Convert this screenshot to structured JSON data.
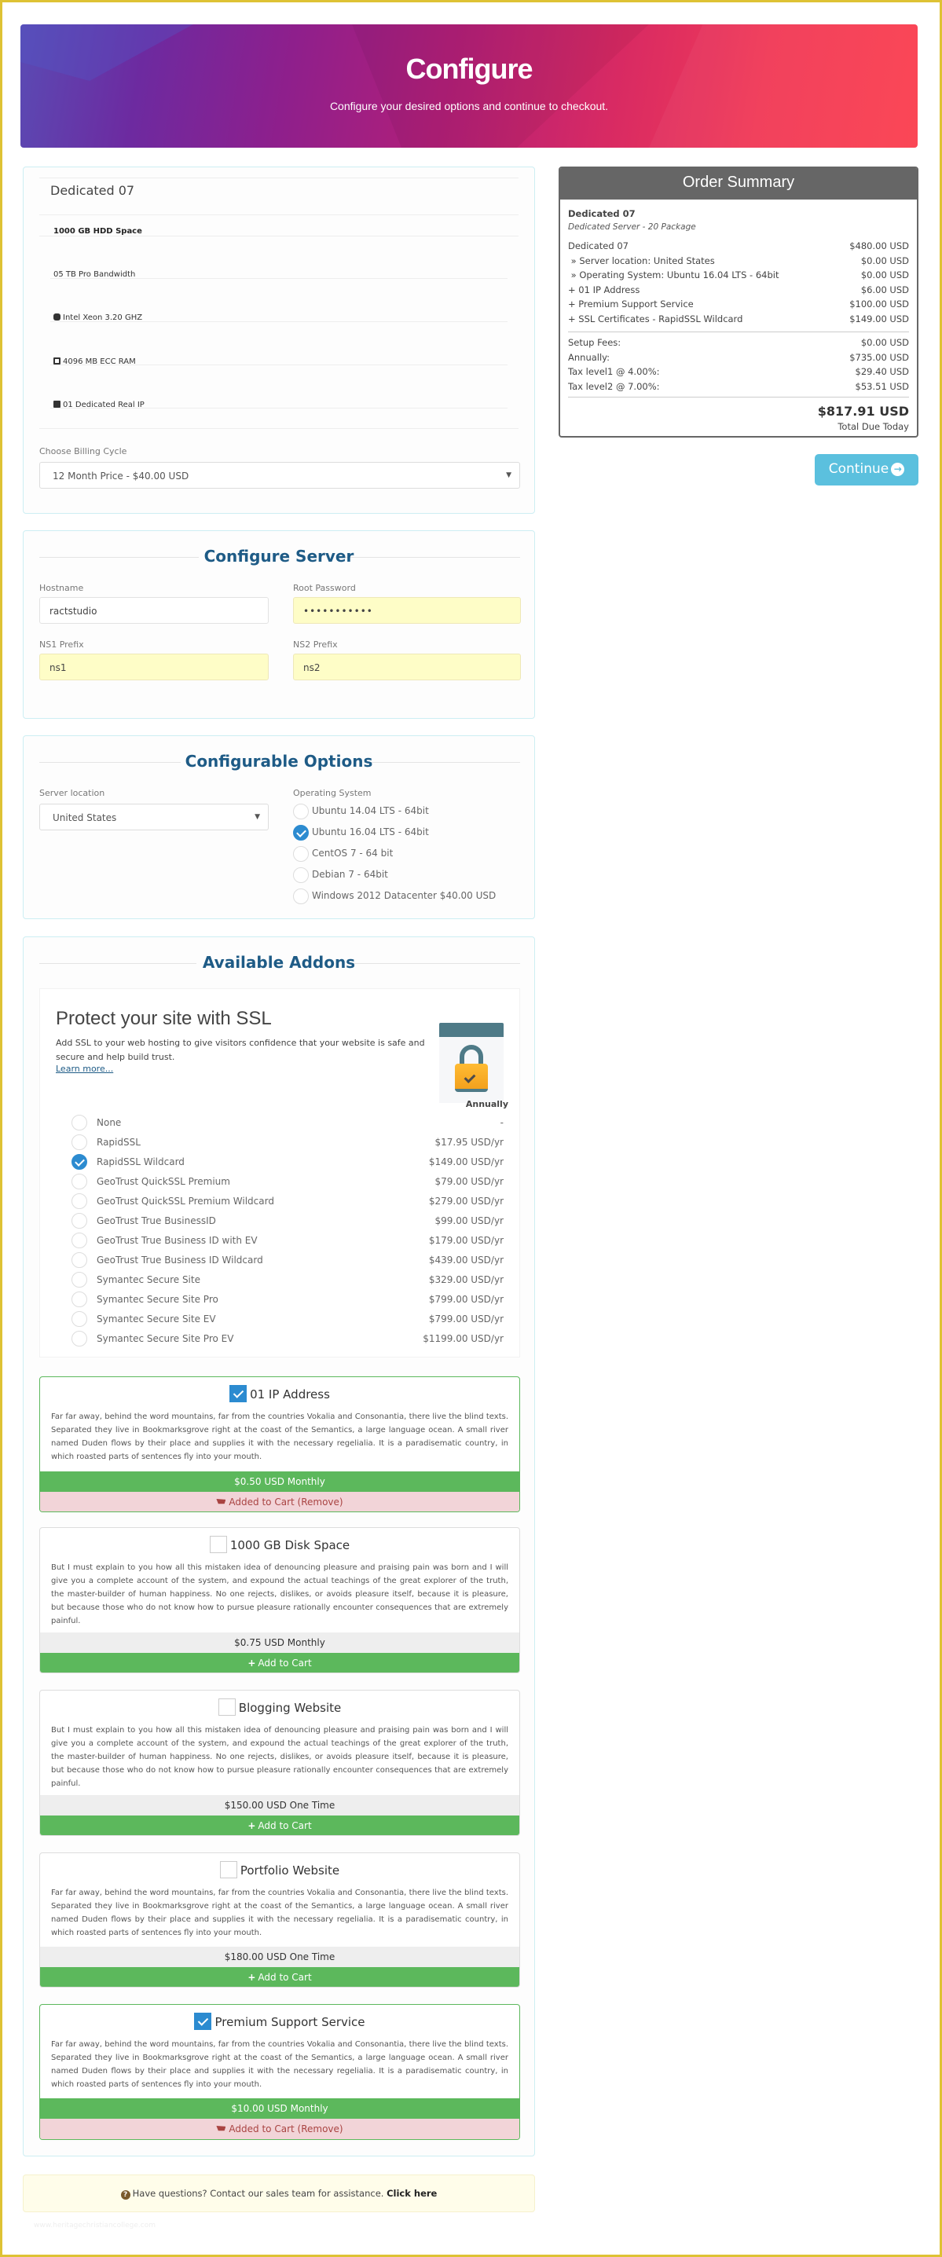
{
  "header": {
    "title": "Configure",
    "subtitle": "Configure your desired options and continue to checkout."
  },
  "product": {
    "name": "Dedicated 07",
    "features": [
      {
        "icon": "none",
        "text": "1000 GB HDD Space"
      },
      {
        "icon": "none",
        "text": "05 TB Pro Bandwidth"
      },
      {
        "icon": "database-icon",
        "text": "Intel Xeon 3.20 GHZ"
      },
      {
        "icon": "columns-icon",
        "text": "4096 MB ECC RAM"
      },
      {
        "icon": "server-icon",
        "text": "01 Dedicated Real IP"
      }
    ],
    "billing_label": "Choose Billing Cycle",
    "billing_value": "12 Month Price - $40.00 USD"
  },
  "configure_server": {
    "title": "Configure Server",
    "hostname_label": "Hostname",
    "hostname_value": "ractstudio",
    "password_label": "Root Password",
    "password_value": "•••••••••••",
    "ns1_label": "NS1 Prefix",
    "ns1_value": "ns1",
    "ns2_label": "NS2 Prefix",
    "ns2_value": "ns2"
  },
  "configurable_options": {
    "title": "Configurable Options",
    "location_label": "Server location",
    "location_value": "United States",
    "os_label": "Operating System",
    "os_options": [
      {
        "label": "Ubuntu 14.04 LTS - 64bit",
        "selected": false
      },
      {
        "label": "Ubuntu 16.04 LTS - 64bit",
        "selected": true
      },
      {
        "label": "CentOS 7 - 64 bit",
        "selected": false
      },
      {
        "label": "Debian 7 - 64bit",
        "selected": false
      },
      {
        "label": "Windows 2012 Datacenter $40.00 USD",
        "selected": false
      }
    ]
  },
  "addons": {
    "title": "Available Addons",
    "ssl": {
      "title": "Protect your site with SSL",
      "description": "Add SSL to your web hosting to give visitors confidence that your website is safe and secure and help build trust.",
      "learn_more": "Learn more...",
      "column_header": "Annually",
      "options": [
        {
          "name": "None",
          "price": "-",
          "selected": false
        },
        {
          "name": "RapidSSL",
          "price": "$17.95 USD/yr",
          "selected": false
        },
        {
          "name": "RapidSSL Wildcard",
          "price": "$149.00 USD/yr",
          "selected": true
        },
        {
          "name": "GeoTrust QuickSSL Premium",
          "price": "$79.00 USD/yr",
          "selected": false
        },
        {
          "name": "GeoTrust QuickSSL Premium Wildcard",
          "price": "$279.00 USD/yr",
          "selected": false
        },
        {
          "name": "GeoTrust True BusinessID",
          "price": "$99.00 USD/yr",
          "selected": false
        },
        {
          "name": "GeoTrust True Business ID with EV",
          "price": "$179.00 USD/yr",
          "selected": false
        },
        {
          "name": "GeoTrust True Business ID Wildcard",
          "price": "$439.00 USD/yr",
          "selected": false
        },
        {
          "name": "Symantec Secure Site",
          "price": "$329.00 USD/yr",
          "selected": false
        },
        {
          "name": "Symantec Secure Site Pro",
          "price": "$799.00 USD/yr",
          "selected": false
        },
        {
          "name": "Symantec Secure Site EV",
          "price": "$799.00 USD/yr",
          "selected": false
        },
        {
          "name": "Symantec Secure Site Pro EV",
          "price": "$1199.00 USD/yr",
          "selected": false
        }
      ]
    },
    "items": [
      {
        "name": "01 IP Address",
        "checked": true,
        "description": "Far far away, behind the word mountains, far from the countries Vokalia and Consonantia, there live the blind texts. Separated they live in Bookmarksgrove right at the coast of the Semantics, a large language ocean. A small river named Duden flows by their place and supplies it with the necessary regelialia. It is a paradisematic country, in which roasted parts of sentences fly into your mouth.",
        "price": "$0.50 USD Monthly",
        "action": "Added to Cart (Remove)"
      },
      {
        "name": "1000 GB Disk Space",
        "checked": false,
        "description": "But I must explain to you how all this mistaken idea of denouncing pleasure and praising pain was born and I will give you a complete account of the system, and expound the actual teachings of the great explorer of the truth, the master-builder of human happiness. No one rejects, dislikes, or avoids pleasure itself, because it is pleasure, but because those who do not know how to pursue pleasure rationally encounter consequences that are extremely painful.",
        "price": "$0.75 USD Monthly",
        "action": "Add to Cart"
      },
      {
        "name": "Blogging Website",
        "checked": false,
        "description": "But I must explain to you how all this mistaken idea of denouncing pleasure and praising pain was born and I will give you a complete account of the system, and expound the actual teachings of the great explorer of the truth, the master-builder of human happiness. No one rejects, dislikes, or avoids pleasure itself, because it is pleasure, but because those who do not know how to pursue pleasure rationally encounter consequences that are extremely painful.",
        "price": "$150.00 USD One Time",
        "action": "Add to Cart"
      },
      {
        "name": "Portfolio Website",
        "checked": false,
        "description": "Far far away, behind the word mountains, far from the countries Vokalia and Consonantia, there live the blind texts. Separated they live in Bookmarksgrove right at the coast of the Semantics, a large language ocean. A small river named Duden flows by their place and supplies it with the necessary regelialia. It is a paradisematic country, in which roasted parts of sentences fly into your mouth.",
        "price": "$180.00 USD One Time",
        "action": "Add to Cart"
      },
      {
        "name": "Premium Support Service",
        "checked": true,
        "description": "Far far away, behind the word mountains, far from the countries Vokalia and Consonantia, there live the blind texts. Separated they live in Bookmarksgrove right at the coast of the Semantics, a large language ocean. A small river named Duden flows by their place and supplies it with the necessary regelialia. It is a paradisematic country, in which roasted parts of sentences fly into your mouth.",
        "price": "$10.00 USD Monthly",
        "action": "Added to Cart (Remove)"
      }
    ]
  },
  "order_summary": {
    "title": "Order Summary",
    "product_name": "Dedicated 07",
    "product_group": "Dedicated Server - 20 Package",
    "lines": [
      {
        "label": "Dedicated 07",
        "value": "$480.00 USD"
      },
      {
        "label": " » Server location: United States",
        "value": "$0.00 USD"
      },
      {
        "label": " » Operating System: Ubuntu 16.04 LTS - 64bit",
        "value": "$0.00 USD"
      },
      {
        "label": "+ 01 IP Address",
        "value": "$6.00 USD"
      },
      {
        "label": "+ Premium Support Service",
        "value": "$100.00 USD"
      },
      {
        "label": "+ SSL Certificates - RapidSSL Wildcard",
        "value": "$149.00 USD"
      }
    ],
    "totals": [
      {
        "label": "Setup Fees:",
        "value": "$0.00 USD"
      },
      {
        "label": "Annually:",
        "value": "$735.00 USD"
      },
      {
        "label": "Tax level1 @ 4.00%:",
        "value": "$29.40 USD"
      },
      {
        "label": "Tax level2 @ 7.00%:",
        "value": "$53.51 USD"
      }
    ],
    "total": "$817.91 USD",
    "total_label": "Total Due Today"
  },
  "continue_label": "Continue",
  "help": {
    "text": "Have questions? Contact our sales team for assistance.",
    "link": "Click here"
  },
  "watermark": "www.heritagechristiancollege.com"
}
